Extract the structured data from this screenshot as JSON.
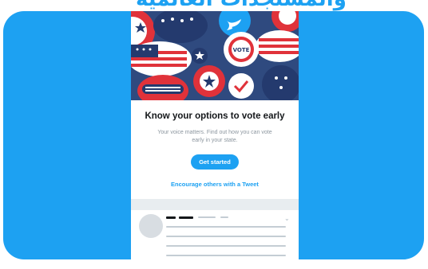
{
  "banner": {
    "text": "والمستجدات العالمية"
  },
  "prompt": {
    "title": "Know your options to vote early",
    "body": "Your voice matters. Find out how you can vote early in your state.",
    "primary_button": "Get started",
    "secondary_link": "Encourage others with a Tweet"
  },
  "colors": {
    "brand_blue": "#1da1f2",
    "flag_red": "#e0323a",
    "flag_navy": "#243a6e"
  },
  "icons": {
    "chevron": "chevron-down-icon",
    "check": "check-icon",
    "bird": "twitter-bird-icon",
    "star": "star-icon"
  }
}
